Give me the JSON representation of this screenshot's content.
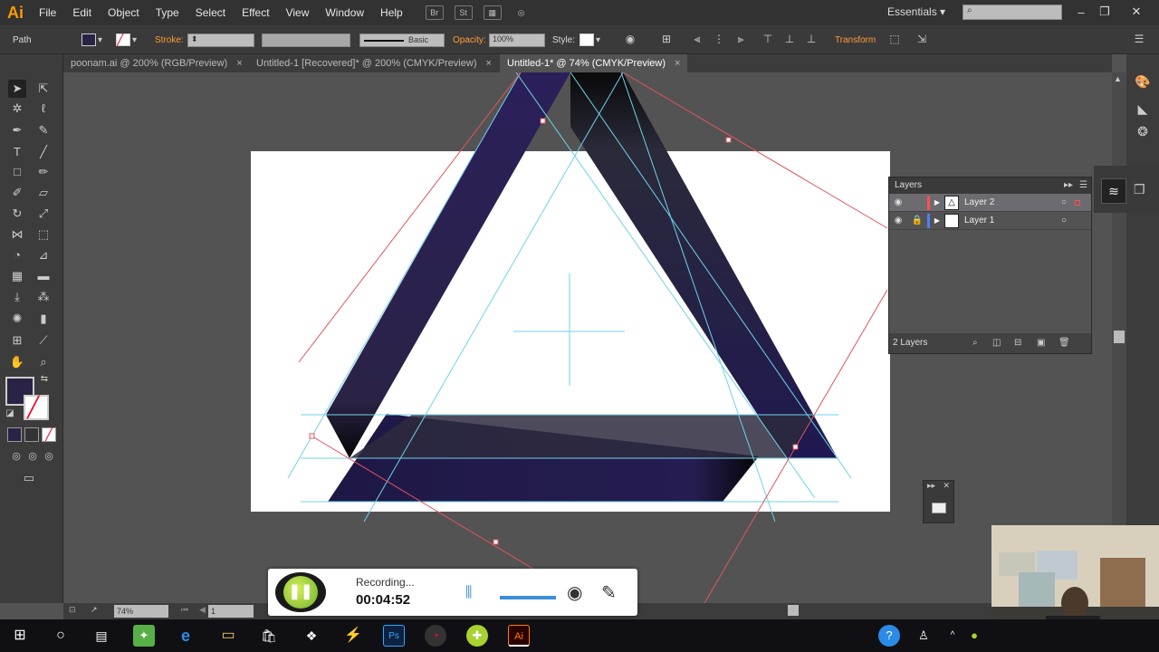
{
  "app": {
    "logo": "Ai"
  },
  "menu": [
    "File",
    "Edit",
    "Object",
    "Type",
    "Select",
    "Effect",
    "View",
    "Window",
    "Help"
  ],
  "menu_icons": {
    "br": "Br",
    "st": "St"
  },
  "workspace": {
    "label": "Essentials"
  },
  "control": {
    "selection_label": "Path",
    "stroke_label": "Stroke:",
    "brush_label": "Basic",
    "opacity_label": "Opacity:",
    "opacity_value": "100%",
    "style_label": "Style:",
    "transform_label": "Transform"
  },
  "tabs": [
    {
      "label": "poonam.ai @ 200% (RGB/Preview)"
    },
    {
      "label": "Untitled-1 [Recovered]* @ 200% (CMYK/Preview)"
    },
    {
      "label": "Untitled-1* @ 74% (CMYK/Preview)"
    }
  ],
  "layers_panel": {
    "title": "Layers",
    "layers": [
      {
        "name": "Layer 2",
        "color": "#ff4f4f"
      },
      {
        "name": "Layer 1",
        "color": "#4f7fff"
      }
    ],
    "count_text": "2 Layers"
  },
  "status": {
    "zoom": "74%",
    "artboard": "1"
  },
  "recorder": {
    "status": "Recording...",
    "time": "00:04:52"
  },
  "colors": {
    "fill": "#2a2345",
    "triangle_dark": "#221a4a",
    "guide": "#6fd3e8",
    "path": "#e0555f"
  },
  "icons": [
    "selection-tool-icon",
    "direct-selection-tool-icon",
    "pen-tool-icon",
    "type-tool-icon",
    "rectangle-tool-icon",
    "brush-tool-icon",
    "rotate-tool-icon",
    "eyedropper-tool-icon",
    "hand-tool-icon",
    "zoom-tool-icon"
  ]
}
